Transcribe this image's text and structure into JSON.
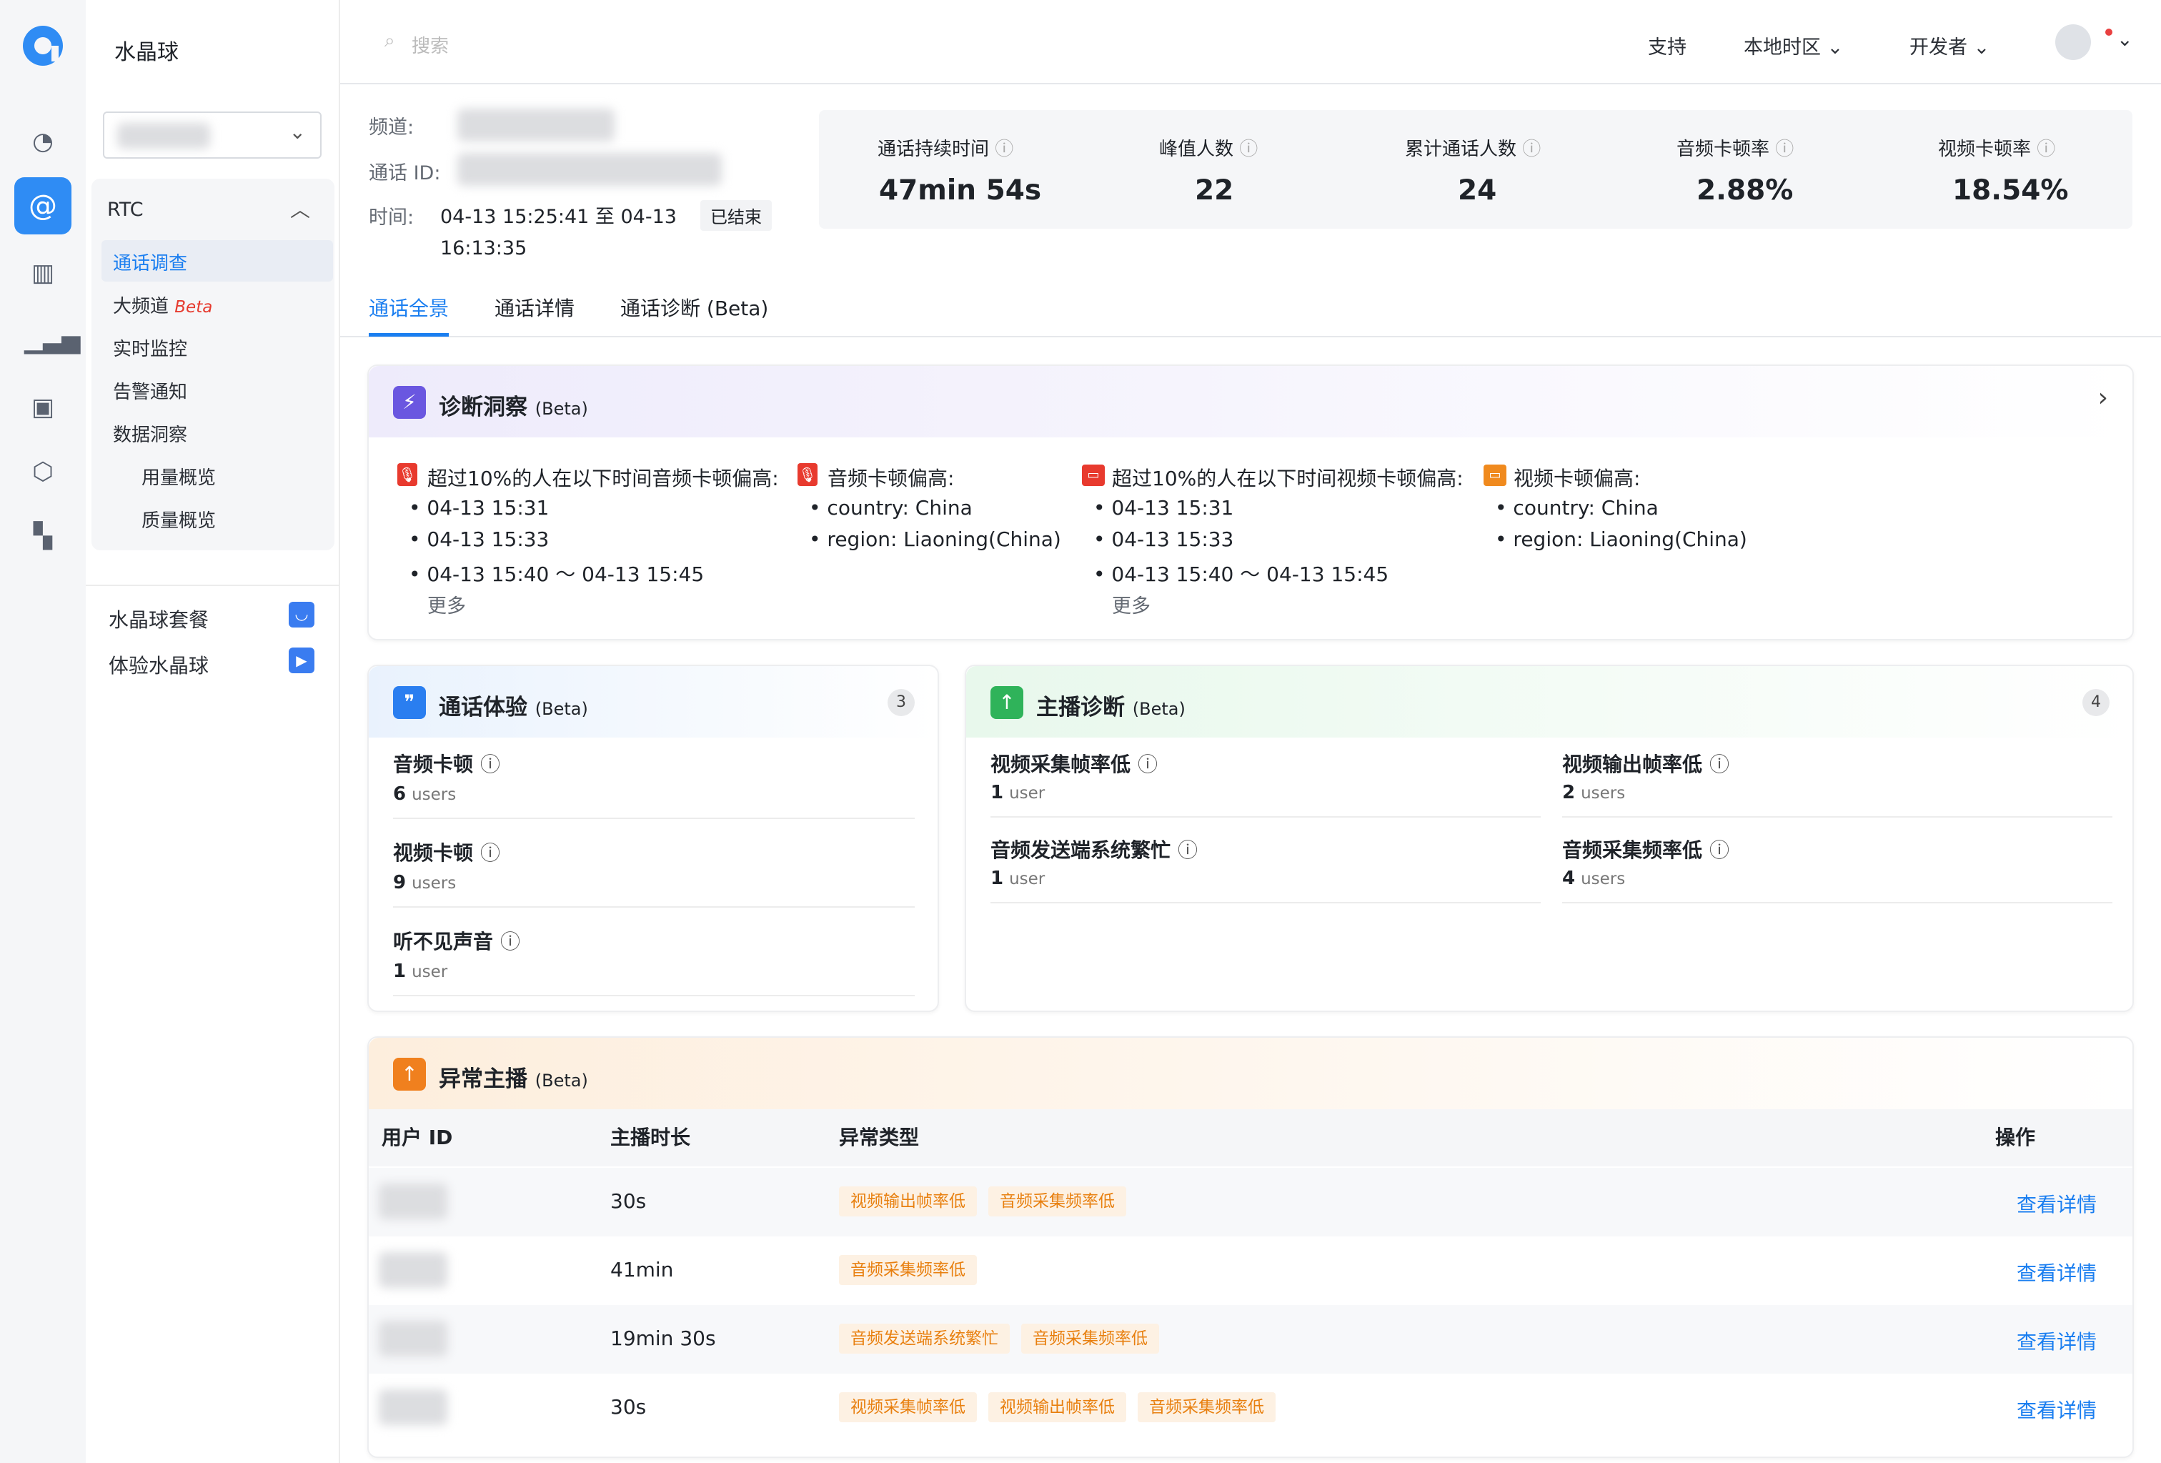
{
  "app": {
    "project": "水晶球",
    "module": "RTC"
  },
  "menu": [
    "通话调查",
    "大频道",
    "实时监控",
    "告警通知",
    "数据洞察",
    "用量概览",
    "质量概览"
  ],
  "beta": "Beta",
  "bottom": [
    "水晶球套餐",
    "体验水晶球"
  ],
  "search": "搜索",
  "topnav": [
    "支持",
    "本地时区",
    "开发者"
  ],
  "info": {
    "channel": "频道:",
    "callid": "通话 ID:",
    "time": "时间:",
    "time_value": "04-13 15:25:41 至 04-13 16:13:35",
    "status": "已结束"
  },
  "stats": [
    [
      "通话持续时间",
      "47min 54s"
    ],
    [
      "峰值人数",
      "22"
    ],
    [
      "累计通话人数",
      "24"
    ],
    [
      "音频卡顿率",
      "2.88%"
    ],
    [
      "视频卡顿率",
      "18.54%"
    ]
  ],
  "tabs": [
    "通话全景",
    "通话详情",
    "通话诊断 (Beta)"
  ],
  "diag": {
    "title": "诊断洞察",
    "beta": "(Beta)",
    "c1": "超过10%的人在以下时间音频卡顿偏高:",
    "c2": "音频卡顿偏高:",
    "c3": "超过10%的人在以下时间视频卡顿偏高:",
    "c4": "视频卡顿偏高:",
    "times": [
      "04-13 15:31",
      "04-13 15:33",
      "04-13 15:40 ～ 04-13 15:45"
    ],
    "more": "更多",
    "country": "country: China",
    "region": "region: Liaoning(China)"
  },
  "exp": {
    "title": "通话体验",
    "beta": "(Beta)",
    "count": "3",
    "items": [
      [
        "音频卡顿",
        "6",
        "users"
      ],
      [
        "视频卡顿",
        "9",
        "users"
      ],
      [
        "听不见声音",
        "1",
        "user"
      ]
    ]
  },
  "host": {
    "title": "主播诊断",
    "beta": "(Beta)",
    "count": "4",
    "items": [
      [
        "视频采集帧率低",
        "1",
        "user"
      ],
      [
        "视频输出帧率低",
        "2",
        "users"
      ],
      [
        "音频发送端系统繁忙",
        "1",
        "user"
      ],
      [
        "音频采集频率低",
        "4",
        "users"
      ]
    ]
  },
  "abn": {
    "title": "异常主播",
    "beta": "(Beta)",
    "cols": [
      "用户 ID",
      "主播时长",
      "异常类型",
      "操作"
    ],
    "action": "查看详情",
    "rows": [
      [
        "30s",
        [
          "视频输出帧率低",
          "音频采集频率低"
        ]
      ],
      [
        "41min",
        [
          "音频采集频率低"
        ]
      ],
      [
        "19min 30s",
        [
          "音频发送端系统繁忙",
          "音频采集频率低"
        ]
      ],
      [
        "30s",
        [
          "视频采集帧率低",
          "视频输出帧率低",
          "音频采集频率低"
        ]
      ]
    ]
  }
}
